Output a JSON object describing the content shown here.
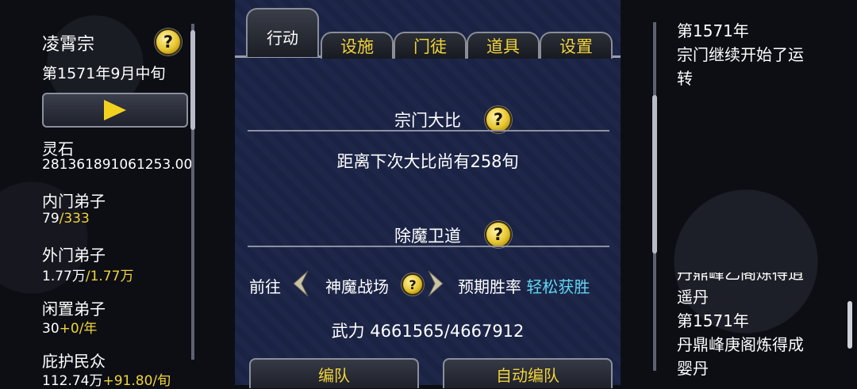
{
  "left": {
    "sect_name": "凌霄宗",
    "date": "第1571年9月中旬",
    "stats": [
      {
        "label": "灵石",
        "value": "281361891061253.00",
        "extra": ""
      },
      {
        "label": "内门弟子",
        "value": "79",
        "extra": "/333"
      },
      {
        "label": "外门弟子",
        "value": "1.77万",
        "extra": "/1.77万"
      },
      {
        "label": "闲置弟子",
        "value": "30",
        "extra": "+0/年"
      },
      {
        "label": "庇护民众",
        "value": "112.74万",
        "extra": "+91.80/旬"
      }
    ]
  },
  "tabs": [
    "行动",
    "设施",
    "门徒",
    "道具",
    "设置"
  ],
  "center": {
    "tournament": {
      "title": "宗门大比",
      "countdown": "距离下次大比尚有258旬"
    },
    "demon": {
      "title": "除魔卫道",
      "goto": "前往",
      "place": "神魔战场",
      "win_label": "预期胜率",
      "win_value": "轻松获胜",
      "power": "武力 4661565/4667912"
    },
    "buttons": {
      "team": "编队",
      "auto_team": "自动编队"
    }
  },
  "log": [
    "第1571年",
    "宗门继续开始了运",
    "转",
    "丹鼎峰乙阁炼得逍",
    "遥丹",
    "第1571年",
    "丹鼎峰庚阁炼得成",
    "婴丹"
  ],
  "icons": {
    "help": "?"
  },
  "colors": {
    "accent": "#f0d33a",
    "cyan": "#5fd6f2",
    "panel": "#1b2344"
  }
}
